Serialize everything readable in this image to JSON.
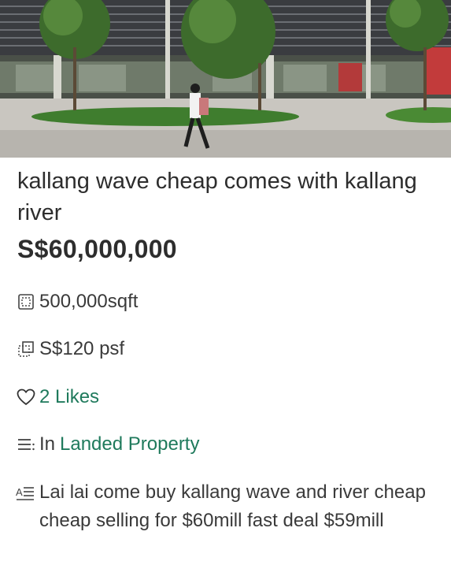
{
  "listing": {
    "photo_icon": "listing-photo",
    "title": "kallang wave cheap comes with kallang river",
    "price": "S$60,000,000",
    "area": "500,000sqft",
    "psf": "S$120 psf",
    "likes": "2 Likes",
    "category_prefix": "In",
    "category": "Landed Property",
    "description": "Lai lai come buy kallang wave and river cheap cheap selling for $60mill fast deal $59mill"
  },
  "icons": {
    "area": "floor-area-icon",
    "psf": "price-per-sqft-icon",
    "likes": "heart-icon",
    "category": "list-icon",
    "description": "description-icon"
  },
  "colors": {
    "accent": "#1f7a5c",
    "text": "#2d2d2d"
  }
}
